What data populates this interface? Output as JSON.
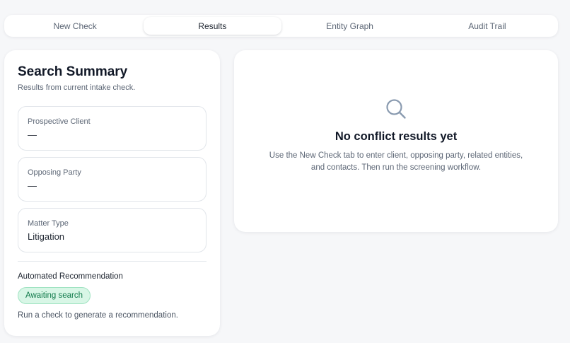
{
  "tabs": [
    {
      "label": "New Check",
      "active": false
    },
    {
      "label": "Results",
      "active": true
    },
    {
      "label": "Entity Graph",
      "active": false
    },
    {
      "label": "Audit Trail",
      "active": false
    }
  ],
  "summary": {
    "title": "Search Summary",
    "subtitle": "Results from current intake check.",
    "fields": [
      {
        "label": "Prospective Client",
        "value": "—"
      },
      {
        "label": "Opposing Party",
        "value": "—"
      },
      {
        "label": "Matter Type",
        "value": "Litigation"
      }
    ],
    "recommendation": {
      "label": "Automated Recommendation",
      "badge": "Awaiting search",
      "note": "Run a check to generate a recommendation."
    }
  },
  "results": {
    "icon": "search-icon",
    "title": "No conflict results yet",
    "message": "Use the New Check tab to enter client, opposing party, related entities, and contacts. Then run the screening workflow."
  },
  "colors": {
    "background": "#f6f7f9",
    "badge_bg": "#d8f6e6",
    "badge_text": "#117a4b",
    "icon": "#8a9bb0"
  }
}
